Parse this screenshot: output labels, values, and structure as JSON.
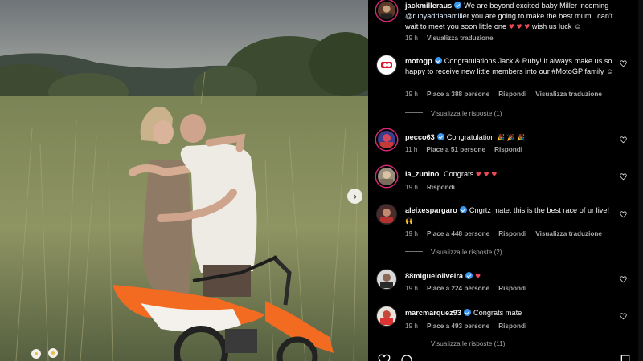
{
  "photo": {
    "next_button_icon": "chevron-right-icon",
    "next_glyph": "›"
  },
  "comments": [
    {
      "username": "jackmilleraus",
      "verified": true,
      "text_before": "We are beyond excited baby Miller incoming ",
      "mention": "@rubyadrianamiller",
      "text_after": " you are going to make the best mum.. can't wait to meet you soon little one ",
      "emoji": "♥ ♥ ♥",
      "text_end": " wish us luck ☺",
      "time": "19 h",
      "actions": [
        "Visualizza traduzione"
      ],
      "avatar_icon": "profile-avatar-icon"
    },
    {
      "username": "motogp",
      "verified": true,
      "text": "Congratulations Jack & Ruby! It always make us so happy to receive new little members into our #MotoGP family ☺",
      "time": "19 h",
      "likes": "Piace a 388 persone",
      "actions": [
        "Rispondi",
        "Visualizza traduzione"
      ],
      "view_replies": "Visualizza le risposte (1)"
    },
    {
      "username": "pecco63",
      "verified": true,
      "text": "Congratulation",
      "emoji": "🎉 🎉 🎉",
      "time": "11 h",
      "likes": "Piace a 51 persone",
      "actions": [
        "Rispondi"
      ]
    },
    {
      "username": "la_zunino",
      "verified": false,
      "text": "Congrats",
      "emoji": "♥ ♥ ♥",
      "time": "19 h",
      "actions": [
        "Rispondi"
      ]
    },
    {
      "username": "aleixespargaro",
      "verified": true,
      "text": "Cngrtz mate, this is the best race of ur live!",
      "emoji": "🙌",
      "time": "19 h",
      "likes": "Piace a 448 persone",
      "actions": [
        "Rispondi",
        "Visualizza traduzione"
      ],
      "view_replies": "Visualizza le risposte (2)"
    },
    {
      "username": "88migueloliveira",
      "verified": true,
      "text": "",
      "emoji": "♥",
      "time": "19 h",
      "likes": "Piace a 224 persone",
      "actions": [
        "Rispondi"
      ]
    },
    {
      "username": "marcmarquez93",
      "verified": true,
      "text": "Congrats mate",
      "emoji": "",
      "time": "19 h",
      "likes": "Piace a 493 persone",
      "actions": [
        "Rispondi"
      ],
      "view_replies": "Visualizza le risposte (11)"
    }
  ],
  "colors": {
    "background": "#000000",
    "text": "#f5f5f5",
    "secondary": "#a8a8a8",
    "verified": "#3897f0",
    "heart": "#ed4956",
    "motorbike": "#f26b21"
  }
}
